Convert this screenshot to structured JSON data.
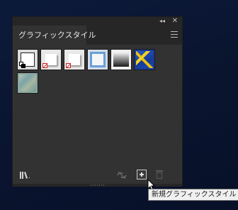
{
  "panel": {
    "tab_label": "グラフィックスタイル"
  },
  "swatches": [
    {
      "name": "default-graphic-style"
    },
    {
      "name": "basic-text-style"
    },
    {
      "name": "basic-text-style-none"
    },
    {
      "name": "blue-outline-style"
    },
    {
      "name": "gradient-style"
    },
    {
      "name": "yellow-blue-texture-style"
    },
    {
      "name": "teal-texture-style"
    }
  ],
  "tooltip": {
    "text": "新規グラフィックスタイル"
  },
  "colors": {
    "panel_bg": "#323232",
    "header_bg": "#262626",
    "tab_text": "#e6e6e6",
    "tooltip_bg": "#f0f0f0",
    "accent_blue": "#6a9fd6"
  }
}
